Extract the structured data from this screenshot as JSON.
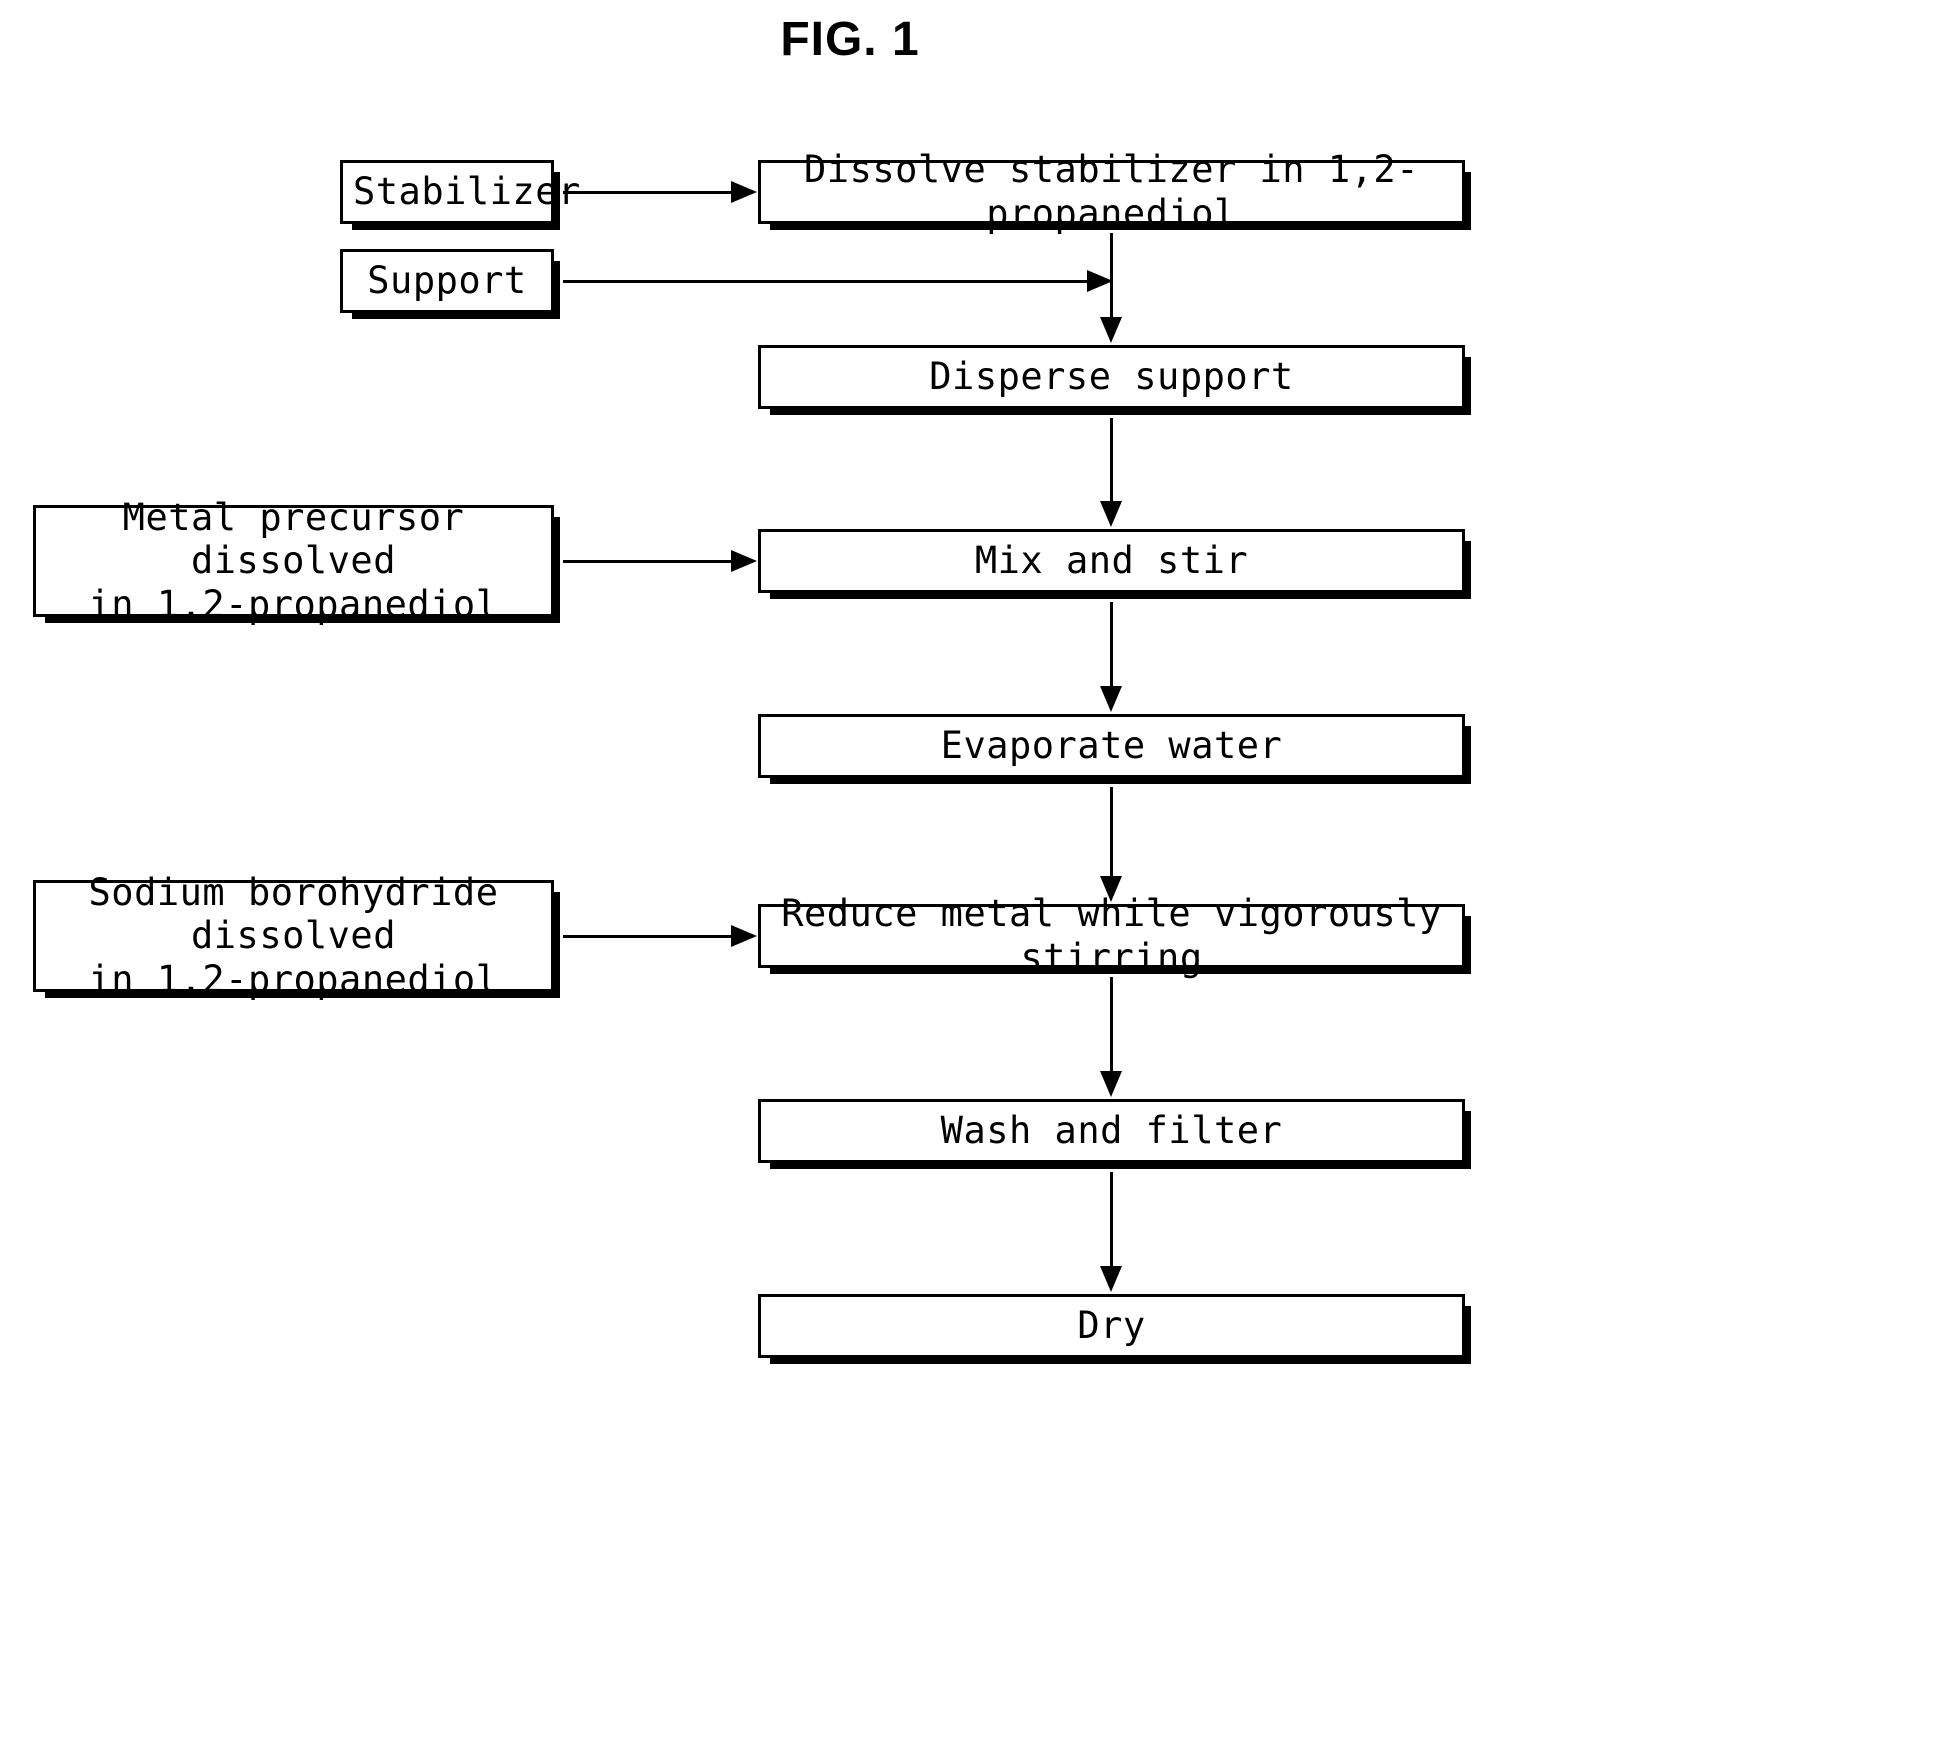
{
  "figure": {
    "title": "FIG. 1"
  },
  "nodes": {
    "stabilizer": "Stabilizer",
    "support": "Support",
    "metal_precursor": "Metal precursor dissolved\nin 1,2-propanediol",
    "sodium_borohydride": "Sodium borohydride dissolved\nin 1,2-propanediol",
    "dissolve_stabilizer": "Dissolve stabilizer in 1,2-propanediol",
    "disperse_support": "Disperse support",
    "mix_and_stir": "Mix and stir",
    "evaporate_water": "Evaporate water",
    "reduce_metal": "Reduce metal while vigorously stirring",
    "wash_and_filter": "Wash and filter",
    "dry": "Dry"
  },
  "flow": {
    "steps": [
      "Dissolve stabilizer in 1,2-propanediol",
      "Disperse support",
      "Mix and stir",
      "Evaporate water",
      "Reduce metal while vigorously stirring",
      "Wash and filter",
      "Dry"
    ],
    "inputs": [
      "Stabilizer",
      "Support",
      "Metal precursor dissolved\nin 1,2-propanediol",
      "Sodium borohydride dissolved\nin 1,2-propanediol"
    ],
    "edges": [
      "Stabilizer -> Dissolve stabilizer in 1,2-propanediol",
      "Dissolve stabilizer in 1,2-propanediol -> Disperse support",
      "Support -> Disperse support",
      "Disperse support -> Mix and stir",
      "Metal precursor dissolved in 1,2-propanediol -> Mix and stir",
      "Mix and stir -> Evaporate water",
      "Evaporate water -> Reduce metal while vigorously stirring",
      "Sodium borohydride dissolved in 1,2-propanediol -> Reduce metal while vigorously stirring",
      "Reduce metal while vigorously stirring -> Wash and filter",
      "Wash and filter -> Dry"
    ]
  },
  "style": {
    "ink": "#000000",
    "paper": "#ffffff"
  }
}
